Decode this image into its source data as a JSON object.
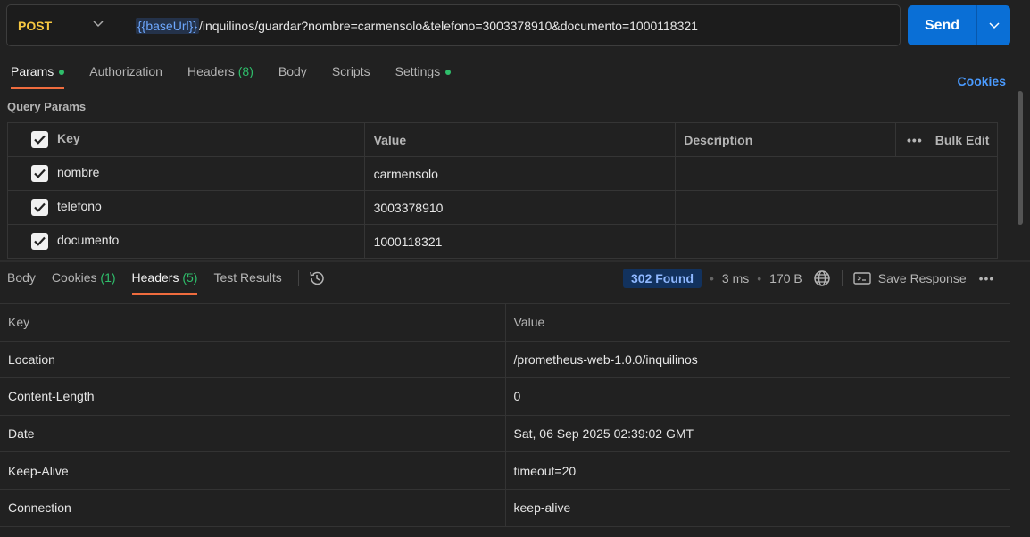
{
  "request": {
    "method": "POST",
    "url_var": "{{baseUrl}}",
    "url_path": "/inquilinos/guardar?nombre=carmensolo&telefono=3003378910&documento=1000118321",
    "send_label": "Send"
  },
  "tabs": {
    "params": "Params",
    "authorization": "Authorization",
    "headers": "Headers",
    "headers_count": "(8)",
    "body": "Body",
    "scripts": "Scripts",
    "settings": "Settings",
    "cookies": "Cookies"
  },
  "query_params": {
    "title": "Query Params",
    "col_key": "Key",
    "col_value": "Value",
    "col_description": "Description",
    "bulk_edit": "Bulk Edit",
    "rows": [
      {
        "key": "nombre",
        "value": "carmensolo",
        "description": ""
      },
      {
        "key": "telefono",
        "value": "3003378910",
        "description": ""
      },
      {
        "key": "documento",
        "value": "1000118321",
        "description": ""
      }
    ]
  },
  "response": {
    "tabs": {
      "body": "Body",
      "cookies": "Cookies",
      "cookies_count": "(1)",
      "headers": "Headers",
      "headers_count": "(5)",
      "test_results": "Test Results"
    },
    "status": "302 Found",
    "time": "3 ms",
    "size": "170 B",
    "save_response": "Save Response",
    "col_key": "Key",
    "col_value": "Value",
    "headers": [
      {
        "key": "Location",
        "value": "/prometheus-web-1.0.0/inquilinos"
      },
      {
        "key": "Content-Length",
        "value": "0"
      },
      {
        "key": "Date",
        "value": "Sat, 06 Sep 2025 02:39:02 GMT"
      },
      {
        "key": "Keep-Alive",
        "value": "timeout=20"
      },
      {
        "key": "Connection",
        "value": "keep-alive"
      }
    ]
  },
  "colors": {
    "method": "#f6c741",
    "send": "#0a6fd6",
    "active_tab": "#ef6c3e",
    "dot": "#2fbe6b",
    "link": "#4a9bff"
  },
  "icons": [
    "chevron-down-icon",
    "checkbox-checked-icon",
    "more-icon",
    "history-icon",
    "globe-icon",
    "save-icon"
  ]
}
